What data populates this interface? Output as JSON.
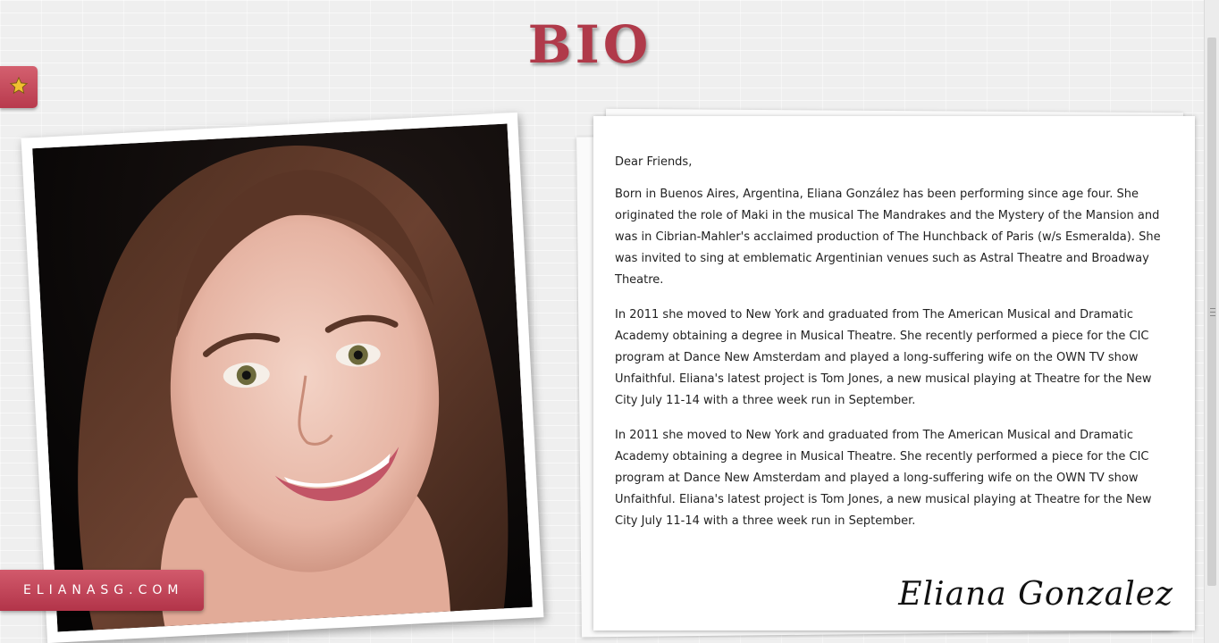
{
  "header": {
    "title": "BIO"
  },
  "sidebar": {
    "star_icon": "star-icon",
    "site_label": "ELIANASG.COM"
  },
  "colors": {
    "accent": "#b83a4d",
    "title": "#b03a4a",
    "star": "#f0c030"
  },
  "letter": {
    "greeting": "Dear Friends,",
    "paragraphs": [
      "Born in Buenos Aires, Argentina, Eliana González has been performing since age four. She originated the role of Maki in the musical The Mandrakes and the Mystery of the Mansion and was in Cibrian-Mahler's acclaimed production of The Hunchback of Paris (w/s Esmeralda). She was invited to sing at emblematic Argentinian venues such as Astral Theatre and Broadway Theatre.",
      "In 2011 she moved to New York and graduated from The American Musical and Dramatic Academy obtaining a degree in Musical Theatre. She recently performed a piece for the CIC program at Dance New Amsterdam and played a long-suffering wife on the OWN TV show Unfaithful. Eliana's latest project is Tom Jones, a new musical playing at Theatre for the New City July 11-14 with a three week run in September.",
      "In 2011 she moved to New York and graduated from The American Musical and Dramatic Academy obtaining a degree in Musical Theatre. She recently performed a piece for the CIC program at Dance New Amsterdam and played a long-suffering wife on the OWN TV show Unfaithful. Eliana's latest project is Tom Jones, a new musical playing at Theatre for the New City July 11-14 with a three week run in September."
    ],
    "signature": "Eliana Gonzalez"
  }
}
